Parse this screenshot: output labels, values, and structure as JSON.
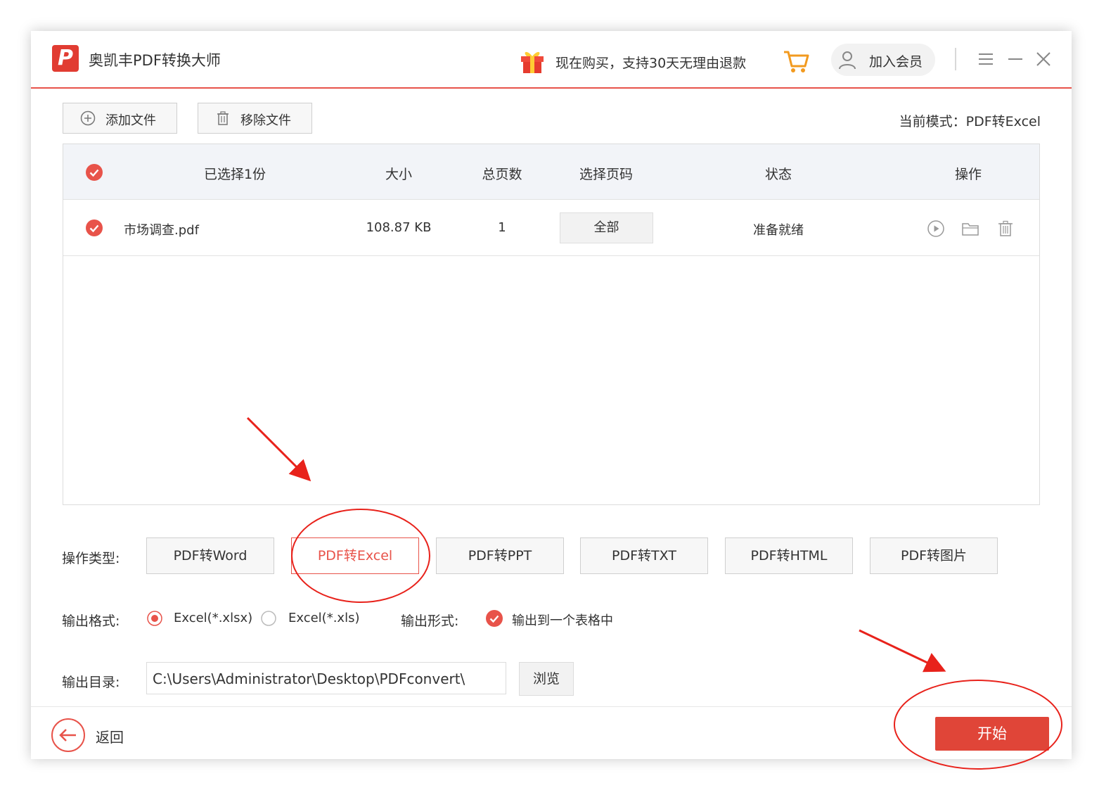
{
  "app": {
    "title": "奥凯丰PDF转换大师",
    "logo_text": "P",
    "promo_text": "现在购买，支持30天无理由退款",
    "member_label": "加入会员"
  },
  "toolbar": {
    "add_label": "添加文件",
    "remove_label": "移除文件",
    "mode_text": "当前模式：PDF转Excel"
  },
  "table": {
    "headers": {
      "selected": "已选择1份",
      "size": "大小",
      "pages": "总页数",
      "page_select": "选择页码",
      "status": "状态",
      "actions": "操作"
    },
    "rows": [
      {
        "name": "市场调查.pdf",
        "size": "108.87 KB",
        "pages": "1",
        "page_range": "全部",
        "status": "准备就绪"
      }
    ]
  },
  "operation": {
    "label": "操作类型:",
    "types": [
      "PDF转Word",
      "PDF转Excel",
      "PDF转PPT",
      "PDF转TXT",
      "PDF转HTML",
      "PDF转图片"
    ],
    "active": "PDF转Excel"
  },
  "output_format": {
    "label": "输出格式:",
    "options": [
      "Excel(*.xlsx)",
      "Excel(*.xls)"
    ],
    "selected": "Excel(*.xlsx)",
    "form_label": "输出形式:",
    "form_option": "输出到一个表格中"
  },
  "output_dir": {
    "label": "输出目录:",
    "path": "C:\\Users\\Administrator\\Desktop\\PDFconvert\\",
    "browse_label": "浏览"
  },
  "footer": {
    "back_label": "返回",
    "start_label": "开始"
  },
  "colors": {
    "accent": "#e8534a",
    "start_button": "#e04538",
    "header_bg": "#f2f4f8"
  }
}
